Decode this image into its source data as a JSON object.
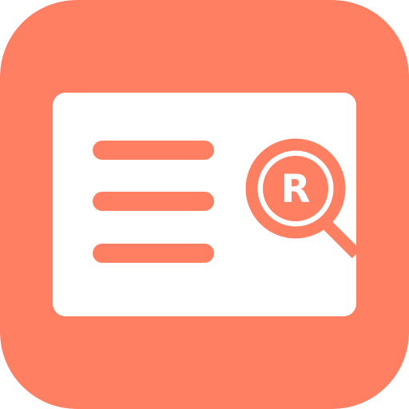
{
  "icon": {
    "name": "trademark-search-app-icon",
    "symbol": "document-with-magnifier",
    "badge_letter": "R",
    "colors": {
      "background": "#FF7F63",
      "card": "#FFFFFF",
      "accent": "#FF7F63"
    }
  }
}
